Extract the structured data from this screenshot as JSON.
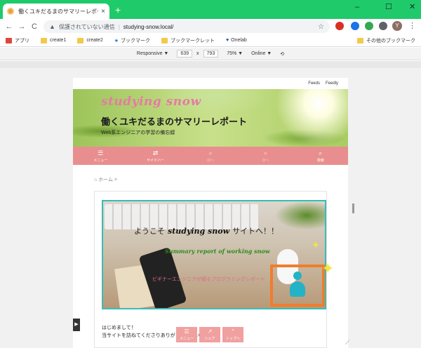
{
  "browser": {
    "tab_title": "働くユキだるまのサマリーレポート - wo",
    "close_glyph": "×",
    "new_tab_glyph": "+",
    "window_controls": [
      "–",
      "☐",
      "✕"
    ],
    "nav": {
      "back": "←",
      "forward": "→",
      "reload": "C"
    },
    "omnibox": {
      "warning": "保護されていない通信",
      "url": "studying-snow.local/"
    },
    "profile_initial": "Y",
    "menu_glyph": "⋮"
  },
  "bookmarks": {
    "items": [
      "アプリ",
      "create1",
      "create2",
      "ブックマーク",
      "ブックマークレット",
      "Onelab"
    ],
    "other": "その他のブックマーク"
  },
  "device_toolbar": {
    "device": "Responsive ▼",
    "width": "639",
    "times": "x",
    "height": "793",
    "zoom": "75% ▼",
    "throttle": "Online ▼"
  },
  "page": {
    "follow": [
      "Feeds",
      "Feedly"
    ],
    "site_title_script": "studying snow",
    "site_title": "働くユキだるまのサマリーレポート",
    "tagline": "Web系エンジニアの学習の備忘録",
    "menu": [
      {
        "icon": "☰",
        "label": "メニュー"
      },
      {
        "icon": "⇄",
        "label": "サイドバー"
      },
      {
        "icon": "«",
        "label": "前へ"
      },
      {
        "icon": "»",
        "label": "次へ"
      },
      {
        "icon": "⌕",
        "label": "検索"
      }
    ],
    "breadcrumb": "ホーム >",
    "eyecatch": {
      "welcome_prefix": "ようこそ",
      "welcome_script": "studying snow",
      "welcome_suffix": "サイトへ！！",
      "summary_script": "Summary report of working snow",
      "subtitle": "ビギナーエンジニアが綴るプログラミングレポート"
    },
    "intro_lines": [
      "はじめまして！",
      "当サイトを訪ねてくださりありがとうございます。"
    ],
    "share": [
      {
        "icon": "☰",
        "label": "メニュー"
      },
      {
        "icon": "↗",
        "label": "シェア"
      },
      {
        "icon": "⌃",
        "label": "トップへ"
      }
    ]
  },
  "colors": {
    "title_bar": "#1fca6a",
    "menu_bar": "#e88e8e",
    "highlight_box": "#f07d2c",
    "frame": "#3bbbb7"
  }
}
